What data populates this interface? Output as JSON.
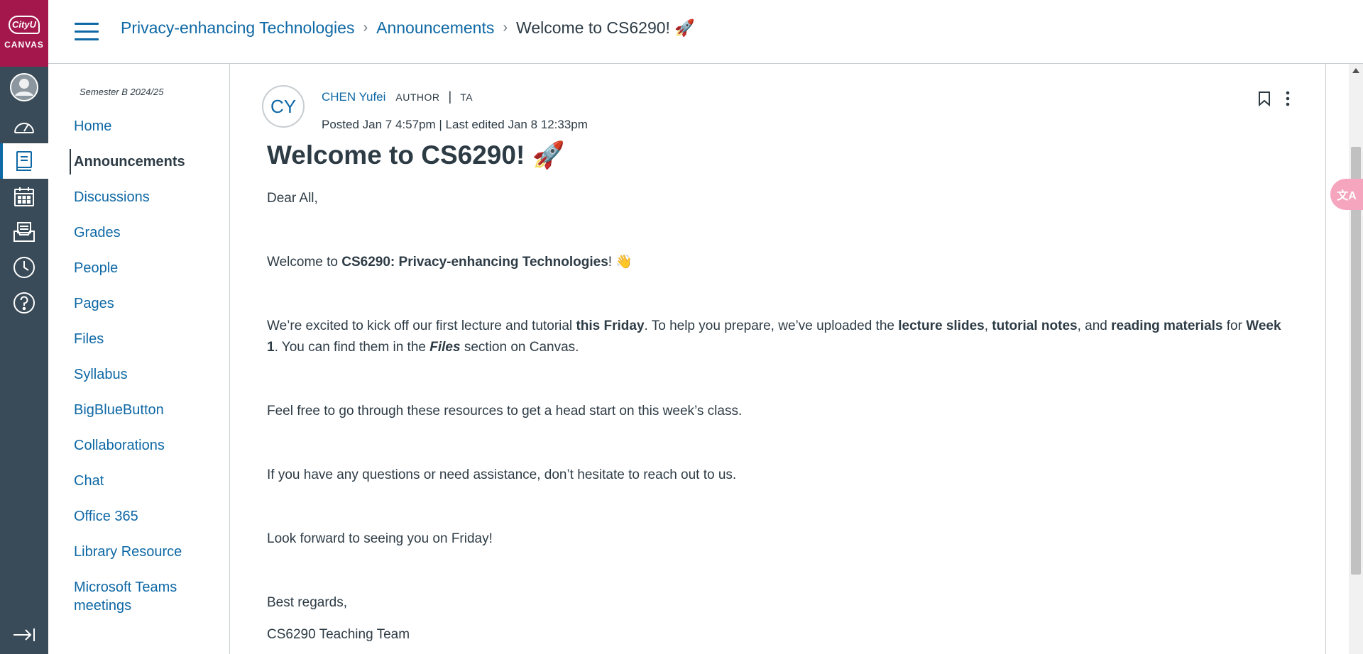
{
  "brand": {
    "logo_top": "CityU",
    "logo_bottom": "CANVAS",
    "color": "#a4174c"
  },
  "global_nav": [
    {
      "icon": "account-avatar-icon"
    },
    {
      "icon": "dashboard-icon"
    },
    {
      "icon": "courses-icon",
      "active": true
    },
    {
      "icon": "calendar-icon"
    },
    {
      "icon": "inbox-icon"
    },
    {
      "icon": "history-icon"
    },
    {
      "icon": "help-icon"
    },
    {
      "icon": "collapse-nav-icon"
    }
  ],
  "header": {
    "breadcrumb": [
      {
        "label": "Privacy-enhancing Technologies"
      },
      {
        "label": "Announcements"
      },
      {
        "label": "Welcome to CS6290! 🚀"
      }
    ]
  },
  "course_nav": {
    "term": "Semester B 2024/25",
    "items": [
      {
        "label": "Home"
      },
      {
        "label": "Announcements",
        "active": true
      },
      {
        "label": "Discussions"
      },
      {
        "label": "Grades"
      },
      {
        "label": "People"
      },
      {
        "label": "Pages"
      },
      {
        "label": "Files"
      },
      {
        "label": "Syllabus"
      },
      {
        "label": "BigBlueButton"
      },
      {
        "label": "Collaborations"
      },
      {
        "label": "Chat"
      },
      {
        "label": "Office 365"
      },
      {
        "label": "Library Resource"
      },
      {
        "label": "Microsoft Teams meetings"
      }
    ]
  },
  "post": {
    "avatar_initials": "CY",
    "author": "CHEN Yufei",
    "role_author": "AUTHOR",
    "role_ta": "TA",
    "posted": "Posted Jan 7 4:57pm",
    "edited": "| Last edited Jan 8 12:33pm",
    "title": "Welcome to CS6290! 🚀",
    "body": {
      "greeting": "Dear All,",
      "p1_pre": "Welcome to ",
      "p1_bold": "CS6290: Privacy-enhancing Technologies",
      "p1_post": "! 👋",
      "p2_a": "We’re excited to kick off our first lecture and tutorial ",
      "p2_b": "this Friday",
      "p2_c": ".  To help you prepare, we’ve uploaded the ",
      "p2_d": "lecture slides",
      "p2_e": ", ",
      "p2_f": "tutorial notes",
      "p2_g": ", and ",
      "p2_h": "reading materials",
      "p2_i": " for ",
      "p2_j": "Week 1",
      "p2_k": ". You can find them in the ",
      "p2_l": "Files",
      "p2_m": " section on Canvas.",
      "p3": "Feel free to go through these resources to get a head start on this week’s class.",
      "p4": "If you have any questions or need assistance, don’t hesitate to reach out to us.",
      "p5": "Look forward to seeing you on Friday!",
      "closing": "Best regards,",
      "signature": "CS6290 Teaching Team"
    }
  },
  "colors": {
    "link": "#0e68a5",
    "nav_bg": "#394b58",
    "text": "#2d3b45"
  }
}
